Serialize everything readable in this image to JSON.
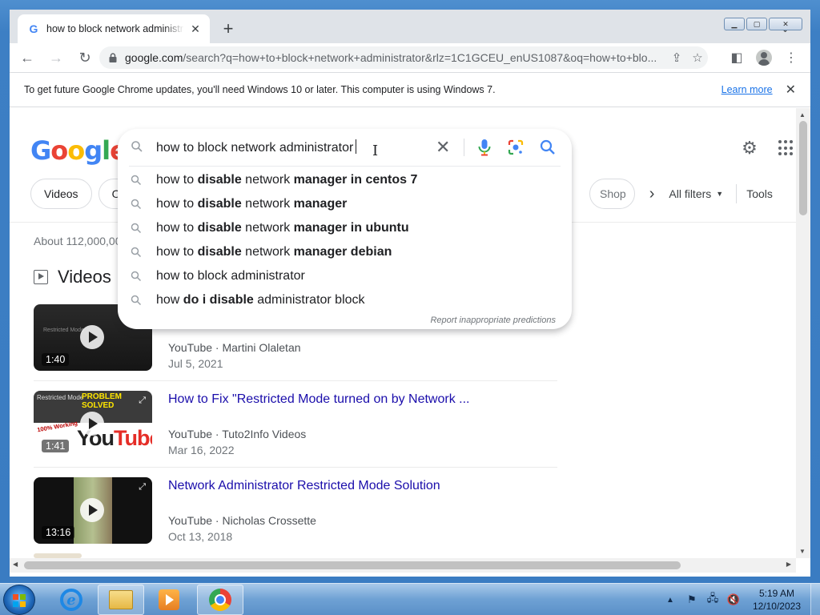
{
  "browser": {
    "tab_title": "how to block network administra",
    "new_tab_label": "+",
    "url_host": "google.com",
    "url_path": "/search?q=how+to+block+network+administrator&rlz=1C1GCEU_enUS1087&oq=how+to+blo...",
    "infobar": {
      "message": "To get future Google Chrome updates, you'll need Windows 10 or later. This computer is using Windows 7.",
      "learn_more": "Learn more"
    }
  },
  "google": {
    "logo_letters": [
      "G",
      "o",
      "o",
      "g",
      "l",
      "e"
    ],
    "search": {
      "query": "how to block network administrator",
      "report": "Report inappropriate predictions",
      "suggestions": [
        {
          "pre": "how to ",
          "b1": "disable",
          "mid": " network ",
          "b2": "manager in centos 7"
        },
        {
          "pre": "how to ",
          "b1": "disable",
          "mid": " network ",
          "b2": "manager"
        },
        {
          "pre": "how to ",
          "b1": "disable",
          "mid": " network ",
          "b2": "manager in ubuntu"
        },
        {
          "pre": "how to ",
          "b1": "disable",
          "mid": " network ",
          "b2": "manager debian"
        },
        {
          "pre": "how to block administrator",
          "b1": "",
          "mid": "",
          "b2": ""
        },
        {
          "pre": "how ",
          "b1": "do i disable",
          "mid": " administrator block",
          "b2": ""
        }
      ]
    },
    "chips": {
      "videos": "Videos",
      "partial": "Or",
      "shop_partial": "Shop",
      "all_filters": "All filters",
      "tools": "Tools"
    },
    "about": "About 112,000,00",
    "videos_heading": "Videos",
    "videos": [
      {
        "title": "",
        "source": "YouTube",
        "channel": "Martini Olaletan",
        "date": "Jul 5, 2021",
        "duration": "1:40"
      },
      {
        "title": "How to Fix \"Restricted Mode turned on by Network ...",
        "source": "YouTube",
        "channel": "Tuto2Info Videos",
        "date": "Mar 16, 2022",
        "duration": "1:41"
      },
      {
        "title": "Network Administrator Restricted Mode Solution",
        "source": "YouTube",
        "channel": "Nicholas Crossette",
        "date": "Oct 13, 2018",
        "duration": "13:16"
      }
    ],
    "thumb2": {
      "problem": "PROBLEM SOLVED",
      "restricted": "Restricted Mode",
      "working": "100% Working",
      "you": "You",
      "tube": "Tube"
    },
    "thumb1": {
      "restricted": "Restricted Mode"
    }
  },
  "taskbar": {
    "time": "5:19 AM",
    "date": "12/10/2023"
  },
  "colors": {
    "link": "#1a0dab",
    "accent": "#1a73e8"
  }
}
